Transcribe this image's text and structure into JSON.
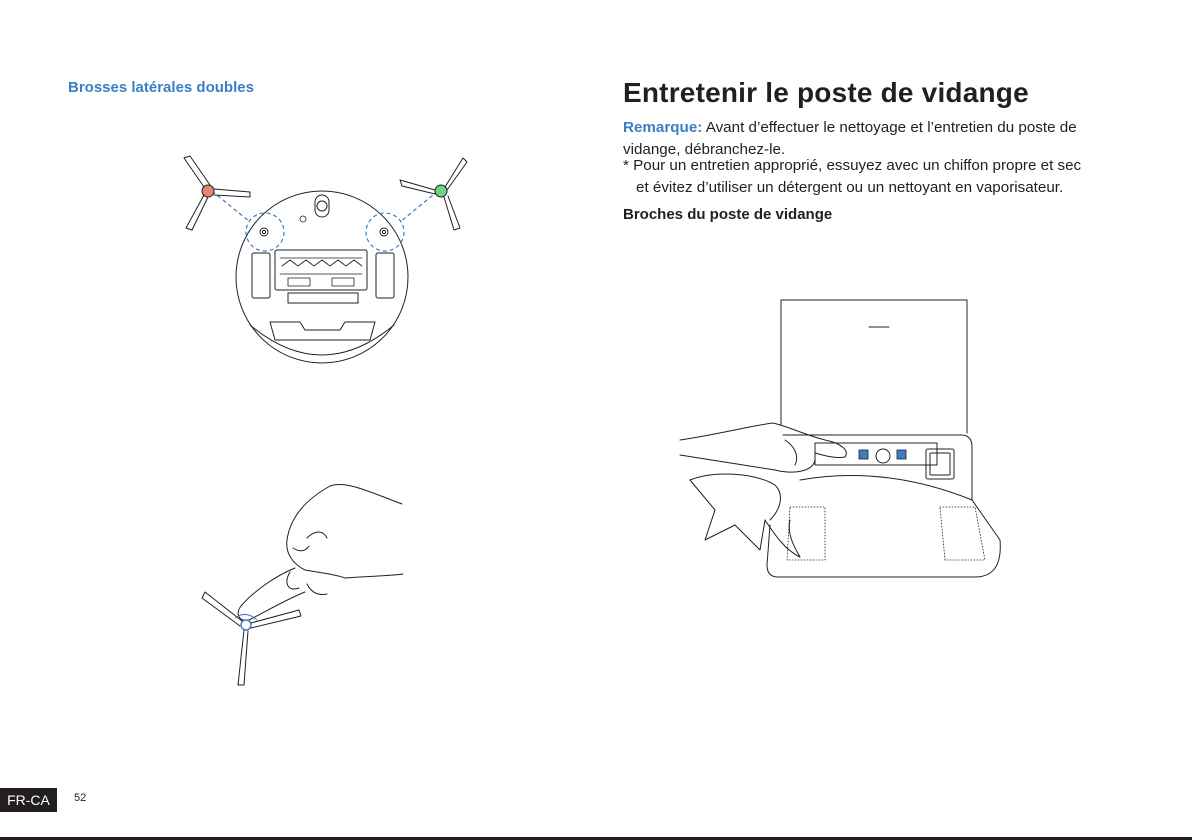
{
  "left": {
    "section_title": "Brosses latérales doubles"
  },
  "right": {
    "title": "Entretenir le poste de vidange",
    "note_label": "Remarque:",
    "note_text": " Avant d’effectuer le nettoyage et l’entretien du poste de vidange, débranchez-le.",
    "tip_line1": "* Pour un entretien approprié, essuyez avec un chiffon propre et sec",
    "tip_line2": "et évitez d’utiliser un détergent ou un nettoyant en vaporisateur.",
    "subheading": "Broches du poste de vidange"
  },
  "footer": {
    "lang": "FR-CA",
    "page": "52"
  },
  "colors": {
    "accent": "#3a7fc4",
    "text": "#231f20",
    "brush_left": "#e8866f",
    "brush_right": "#6fd48a"
  },
  "icons": {
    "robot_illustration": "robot-underside-icon",
    "brush_cleaning_illustration": "hand-holding-brush-icon",
    "station_illustration": "hand-wiping-station-icon"
  }
}
